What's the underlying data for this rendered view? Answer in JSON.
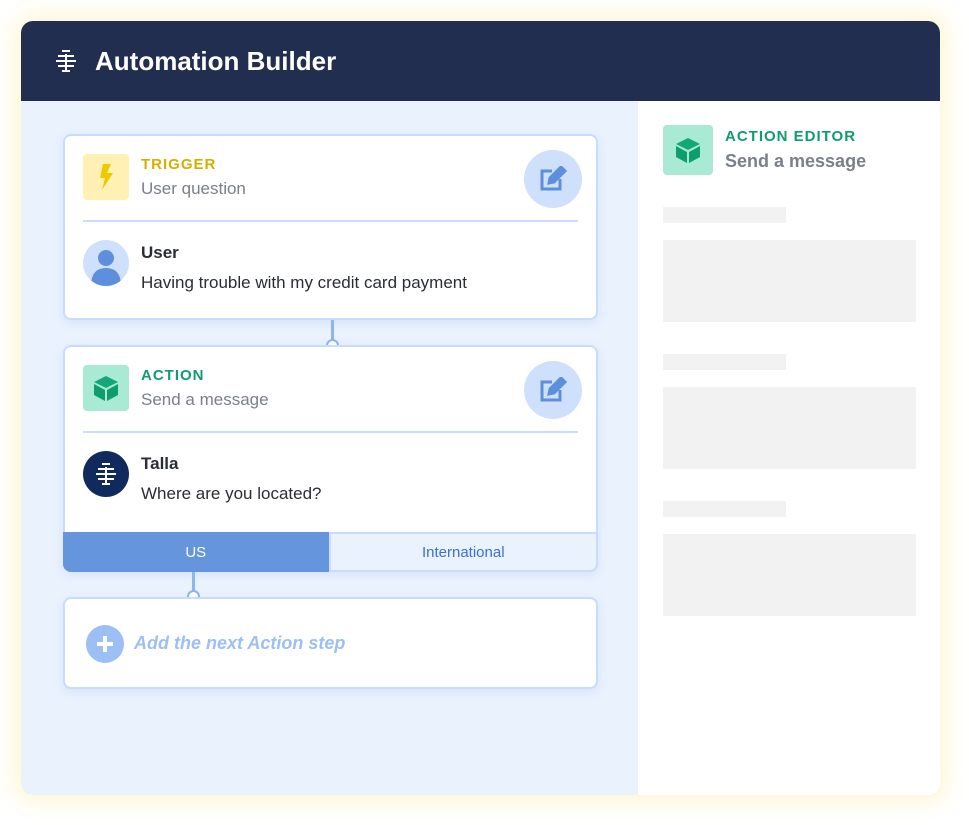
{
  "header": {
    "title": "Automation Builder",
    "logo_icon": "talla-logo-icon"
  },
  "trigger_card": {
    "kind": "TRIGGER",
    "subtitle": "User question",
    "author": "User",
    "message": "Having trouble with my credit card payment",
    "kind_color": "#d4b000"
  },
  "action_card": {
    "kind": "ACTION",
    "subtitle": "Send a message",
    "author": "Talla",
    "message": "Where are you located?",
    "kind_color": "#0f9d6e",
    "tabs": [
      {
        "label": "US",
        "active": true
      },
      {
        "label": "International",
        "active": false
      }
    ]
  },
  "add_step": {
    "label": "Add the next Action step"
  },
  "editor": {
    "kind": "ACTION EDITOR",
    "subtitle": "Send a message"
  }
}
